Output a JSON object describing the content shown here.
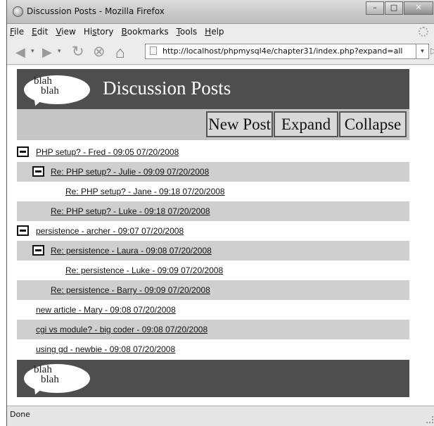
{
  "window": {
    "title": "Discussion Posts - Mozilla Firefox",
    "buttons": {
      "minimize": "–",
      "maximize": "□",
      "close": "✕"
    }
  },
  "menu": {
    "items": [
      {
        "key": "F",
        "rest": "ile"
      },
      {
        "key": "E",
        "rest": "dit"
      },
      {
        "key": "V",
        "rest": "iew"
      },
      {
        "pre": "Hi",
        "key": "s",
        "rest": "tory"
      },
      {
        "key": "B",
        "rest": "ookmarks"
      },
      {
        "key": "T",
        "rest": "ools"
      },
      {
        "key": "H",
        "rest": "elp"
      }
    ]
  },
  "navigation": {
    "back": "◀",
    "forward": "▶",
    "reload": "↻",
    "stop": "⊗",
    "home": "⌂",
    "url": "http://localhost/phpmysql4e/chapter31/index.php?expand=all",
    "go": "▷"
  },
  "page": {
    "logo": {
      "line1": "blah",
      "line2": "blah"
    },
    "title": "Discussion Posts",
    "toolbar": {
      "new_post": "New Post",
      "expand": "Expand",
      "collapse": "Collapse"
    },
    "posts": [
      {
        "text": "PHP setup? - Fred - 09:05 07/20/2008",
        "level": 0,
        "toggle": true,
        "shaded": false
      },
      {
        "text": "Re: PHP setup? - Julie - 09:09 07/20/2008",
        "level": 1,
        "toggle": true,
        "shaded": true
      },
      {
        "text": "Re: PHP setup? - Jane - 09:18 07/20/2008",
        "level": 2,
        "toggle": false,
        "shaded": false
      },
      {
        "text": "Re: PHP setup? - Luke - 09:18 07/20/2008",
        "level": 1,
        "toggle": false,
        "shaded": true
      },
      {
        "text": "persistence - archer - 09:07 07/20/2008",
        "level": 0,
        "toggle": true,
        "shaded": false
      },
      {
        "text": "Re: persistence - Laura - 09:08 07/20/2008",
        "level": 1,
        "toggle": true,
        "shaded": true
      },
      {
        "text": "Re: persistence - Luke - 09:09 07/20/2008",
        "level": 2,
        "toggle": false,
        "shaded": false
      },
      {
        "text": "Re: persistence - Barry - 09:09 07/20/2008",
        "level": 1,
        "toggle": false,
        "shaded": true
      },
      {
        "text": "new article - Mary - 09:08 07/20/2008",
        "level": 0,
        "toggle": false,
        "shaded": false
      },
      {
        "text": "cgi vs module? - big coder - 09:08 07/20/2008",
        "level": 0,
        "toggle": false,
        "shaded": true
      },
      {
        "text": "using gd - newbie - 09:08 07/20/2008",
        "level": 0,
        "toggle": false,
        "shaded": false
      }
    ],
    "footer_logo": {
      "line1": "blah",
      "line2": "blah"
    }
  },
  "status": {
    "text": "Done"
  }
}
